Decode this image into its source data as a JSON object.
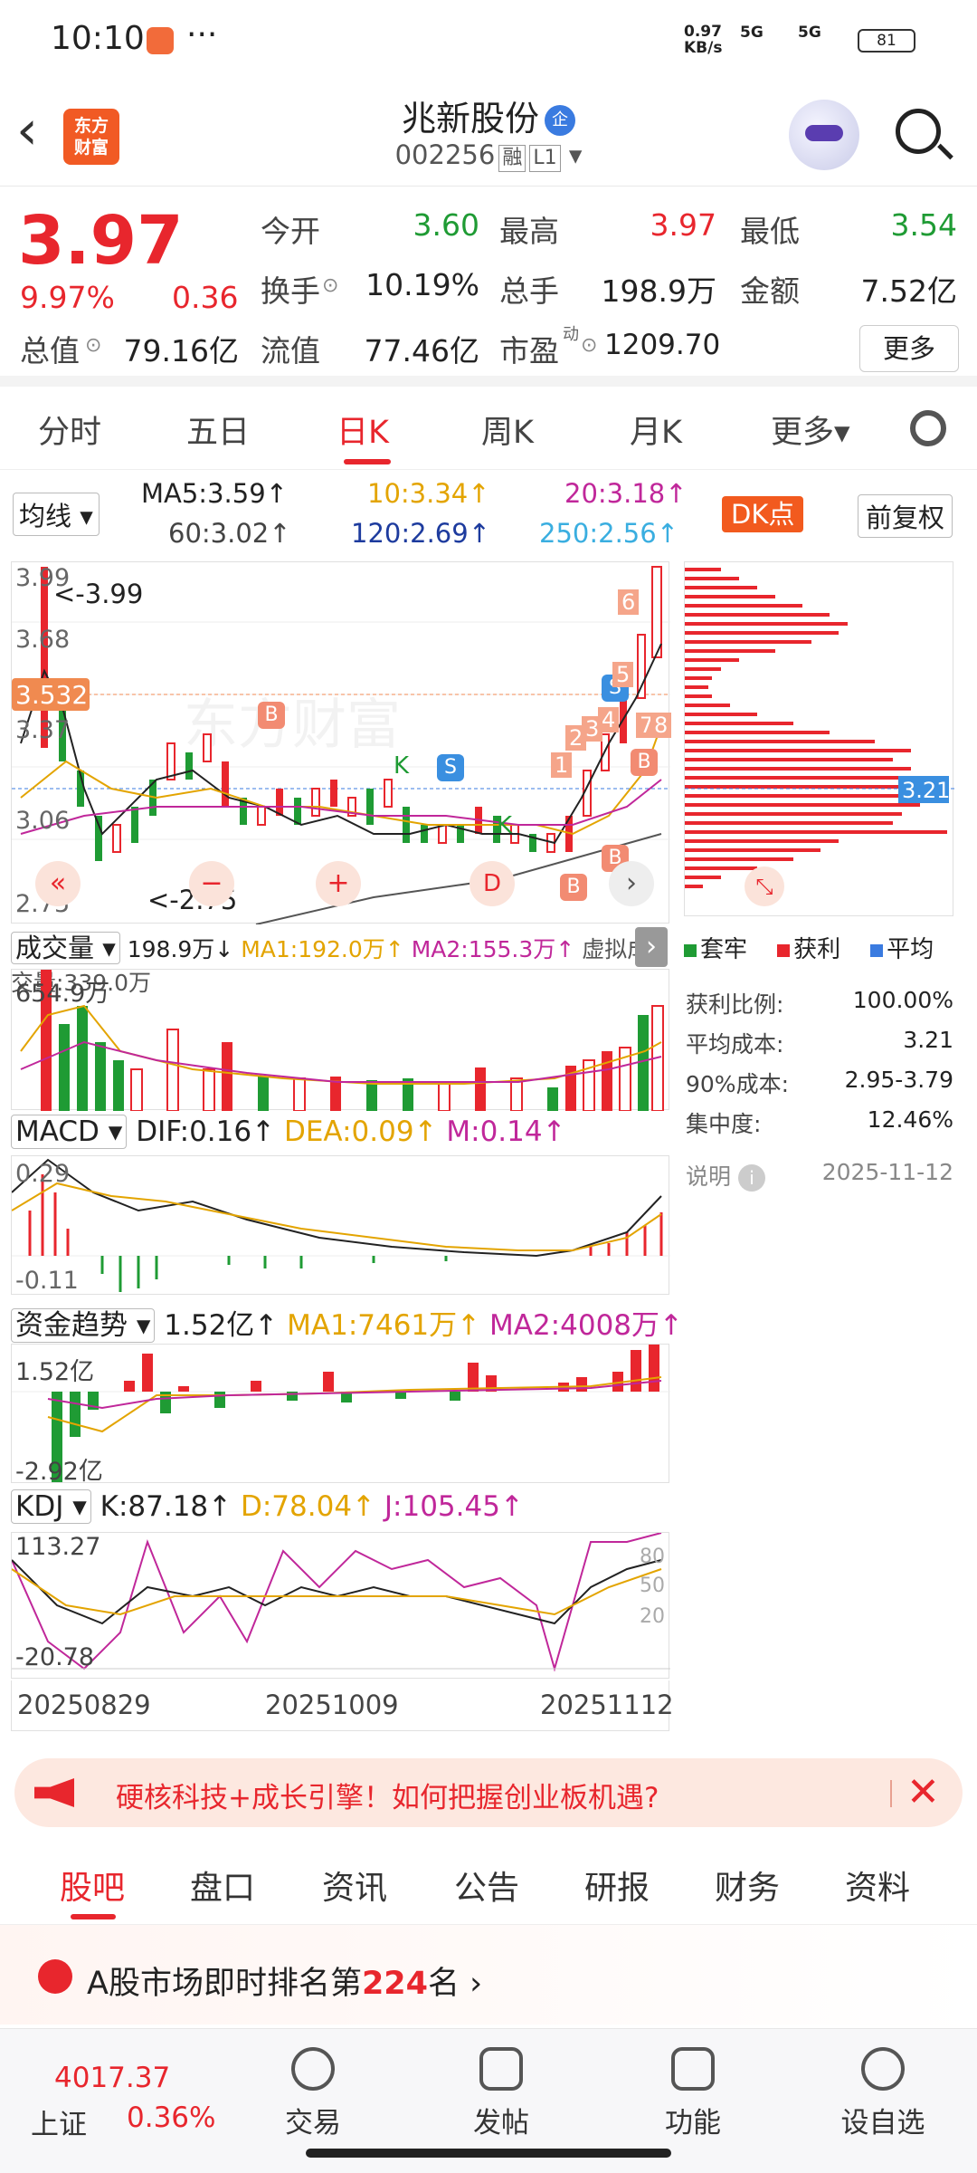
{
  "status_bar": {
    "time": "10:10",
    "dots": "···",
    "net_speed": "0.97\nKB/s",
    "sig1": "5G",
    "sig2": "5G",
    "battery": "81"
  },
  "header": {
    "back": "‹",
    "logo_text": "东方\n财富",
    "title": "兆新股份",
    "title_badge": "企",
    "code": "002256",
    "tag_rong": "融",
    "tag_level": "L1"
  },
  "quote": {
    "price": "3.97",
    "change_pct": "9.97%",
    "change": "0.36",
    "rows": [
      [
        {
          "label": "今开",
          "value": "3.60",
          "color": "green"
        },
        {
          "label": "最高",
          "value": "3.97",
          "color": "red"
        },
        {
          "label": "最低",
          "value": "3.54",
          "color": "green"
        }
      ],
      [
        {
          "label": "换手",
          "value": "10.19%",
          "color": "black"
        },
        {
          "label": "总手",
          "value": "198.9万",
          "color": "black"
        },
        {
          "label": "金额",
          "value": "7.52亿",
          "color": "black"
        }
      ]
    ],
    "zongzhi_label": "总值",
    "zongzhi": "79.16亿",
    "liuzhi_label": "流值",
    "liuzhi": "77.46亿",
    "shiying_label": "市盈",
    "shiying_sup": "动",
    "shiying": "1209.70",
    "more": "更多"
  },
  "period_tabs": [
    "分时",
    "五日",
    "日K",
    "周K",
    "月K",
    "更多▾"
  ],
  "active_period": "日K",
  "ma_bar": {
    "selector": "均线 ▾",
    "ma5": "MA5:3.59↑",
    "ma10": "10:3.34↑",
    "ma20": "20:3.18↑",
    "ma60": "60:3.02↑",
    "ma120": "120:2.69↑",
    "ma250": "250:2.56↑",
    "dk": "DK点",
    "fuquan": "前复权"
  },
  "kline": {
    "y_labels": [
      "3.99",
      "3.68",
      "3.37",
      "3.06",
      "2.75"
    ],
    "price_tag": "3.532",
    "high_note": "<-3.99",
    "low_note": "<-2.75",
    "watermark": "东方财富",
    "marker_b": "B",
    "marker_s": "S",
    "marker_k": "K",
    "marker_d": "D",
    "seq": [
      "1",
      "2",
      "3",
      "4",
      "5",
      "6",
      "7",
      "8"
    ]
  },
  "dist": {
    "avg_tag": "3.21",
    "legend": [
      "套牢",
      "获利",
      "平均"
    ],
    "colors": [
      "#1f9b34",
      "#e8262d",
      "#3a7be0"
    ],
    "stats": [
      {
        "k": "获利比例:",
        "v": "100.00%"
      },
      {
        "k": "平均成本:",
        "v": "3.21"
      },
      {
        "k": "90%成本:",
        "v": "2.95-3.79"
      },
      {
        "k": "集中度:",
        "v": "12.46%"
      }
    ],
    "note_label": "说明",
    "note_date": "2025-11-12"
  },
  "volume": {
    "selector": "成交量 ▾",
    "vol": "198.9万↓",
    "ma1": "MA1:192.0万↑",
    "ma2": "MA2:155.3万↑",
    "virtual": "虚拟成交量:339.0万",
    "y_label": "654.9万"
  },
  "macd": {
    "selector": "MACD ▾",
    "dif": "DIF:0.16↑",
    "dea": "DEA:0.09↑",
    "m": "M:0.14↑",
    "y_top": "0.29",
    "y_bot": "-0.11"
  },
  "fund": {
    "selector": "资金趋势 ▾",
    "val": "1.52亿↑",
    "ma1": "MA1:7461万↑",
    "ma2": "MA2:4008万↑",
    "y_top": "1.52亿",
    "y_bot": "-2.92亿"
  },
  "kdj": {
    "selector": "KDJ ▾",
    "k": "K:87.18↑",
    "d": "D:78.04↑",
    "j": "J:105.45↑",
    "y_top": "113.27",
    "y_bot": "-20.78",
    "r80": "80",
    "r50": "50",
    "r20": "20"
  },
  "dates": [
    "20250829",
    "20251009",
    "20251112"
  ],
  "banner": {
    "text": "硬核科技+成长引擎！如何把握创业板机遇?",
    "close": "✕"
  },
  "bottom_tabs": [
    "股吧",
    "盘口",
    "资讯",
    "公告",
    "研报",
    "财务",
    "资料"
  ],
  "rank": {
    "prefix": "A股市场即时排名第",
    "num": "224",
    "suffix": "名 ›"
  },
  "tabbar": {
    "index_value": "4017.37",
    "index_name": "上证",
    "index_pct": "0.36%",
    "items": [
      "交易",
      "发帖",
      "功能",
      "设自选"
    ]
  }
}
